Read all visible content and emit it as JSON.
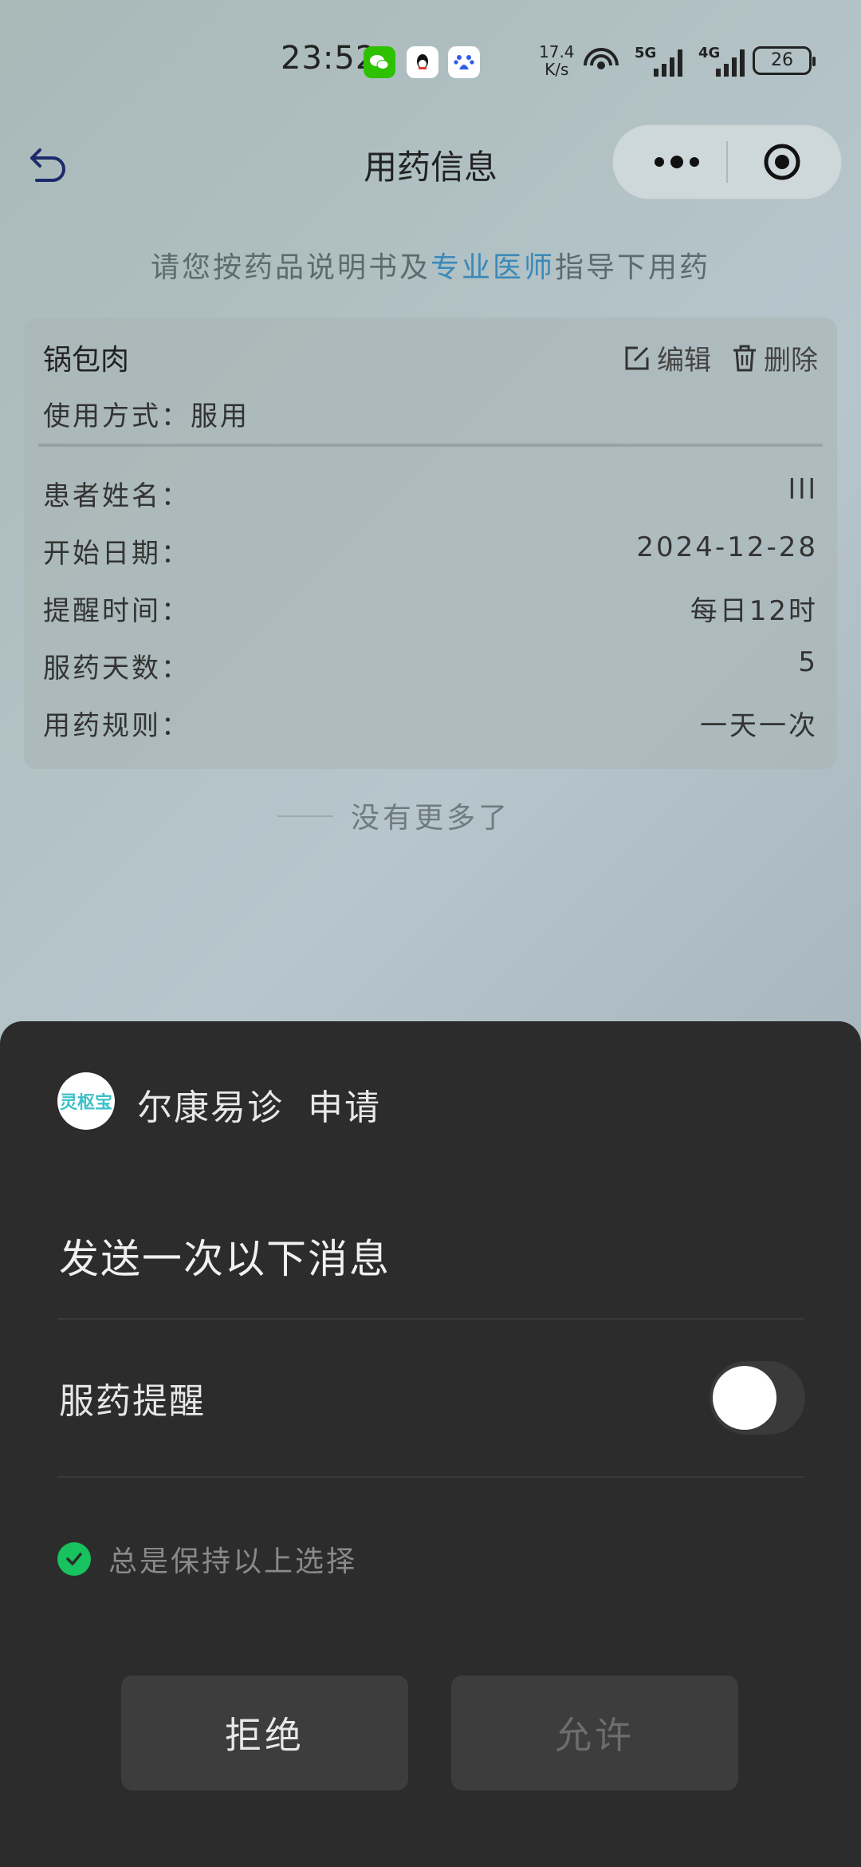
{
  "status_bar": {
    "time": "23:52",
    "speed_value": "17.4",
    "speed_unit": "K/s",
    "net1": "5G",
    "net2": "4G",
    "battery": "26",
    "apps": [
      "wechat-icon",
      "qq-icon",
      "baidu-icon"
    ]
  },
  "nav": {
    "title": "用药信息"
  },
  "notice": {
    "before": "请您按药品说明书及",
    "highlight": "专业医师",
    "after": "指导下用药"
  },
  "medication": {
    "name": "锅包肉",
    "usage": "使用方式：服用",
    "edit_label": "编辑",
    "delete_label": "删除",
    "rows": [
      {
        "label": "患者姓名：",
        "value": "lll"
      },
      {
        "label": "开始日期：",
        "value": "2024-12-28"
      },
      {
        "label": "提醒时间：",
        "value": "每日12时"
      },
      {
        "label": "服药天数：",
        "value": "5"
      },
      {
        "label": "用药规则：",
        "value": "一天一次"
      }
    ]
  },
  "no_more": "没有更多了",
  "sheet": {
    "logo_text": "灵枢宝",
    "app_name": "尔康易诊",
    "request_label": "申请",
    "heading": "发送一次以下消息",
    "item_label": "服药提醒",
    "toggle_on": false,
    "keep_label": "总是保持以上选择",
    "reject_label": "拒绝",
    "allow_label": "允许"
  },
  "colors": {
    "accent_link": "#3a89b8",
    "check_green": "#18c25e",
    "sheet_bg": "#2c2c2c"
  }
}
